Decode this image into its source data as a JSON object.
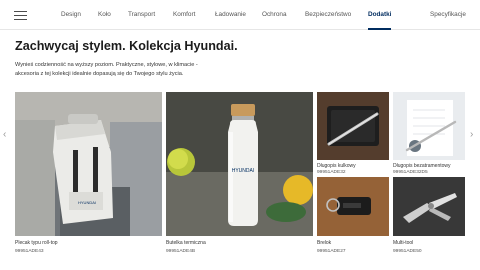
{
  "nav": {
    "items": [
      {
        "label": "Design"
      },
      {
        "label": "Koło"
      },
      {
        "label": "Transport"
      },
      {
        "label": "Komfort"
      },
      {
        "label": "Ładowanie"
      },
      {
        "label": "Ochrona"
      },
      {
        "label": "Bezpieczeństwo"
      },
      {
        "label": "Dodatki"
      },
      {
        "label": "Specyfikacje"
      }
    ],
    "active": "Dodatki"
  },
  "heading": {
    "title": "Zachwycaj stylem. Kolekcja Hyundai.",
    "intro_line1": "Wynieś codzienność na wyższy poziom. Praktyczne, stylowe, w klimacie -",
    "intro_line2": "akcesoria z tej kolekcji idealnie dopasują się do Twojego stylu życia."
  },
  "products": [
    {
      "name": "Plecak typu roll-top",
      "code": "99951ADE43"
    },
    {
      "name": "Butelka termiczna",
      "code": "99951ADE4B"
    },
    {
      "name": "Długopis kulkowy",
      "code": "99951ADE32"
    },
    {
      "name": "Długopis bezatramentowy",
      "code": "99951ADE32D5"
    },
    {
      "name": "Brelok",
      "code": "99951ADE27"
    },
    {
      "name": "Multi-tool",
      "code": "99951ADE50"
    }
  ],
  "bottle_brand": "HYUNDAI",
  "colors": {
    "brand": "#002c5f",
    "text": "#1c1c1c"
  }
}
